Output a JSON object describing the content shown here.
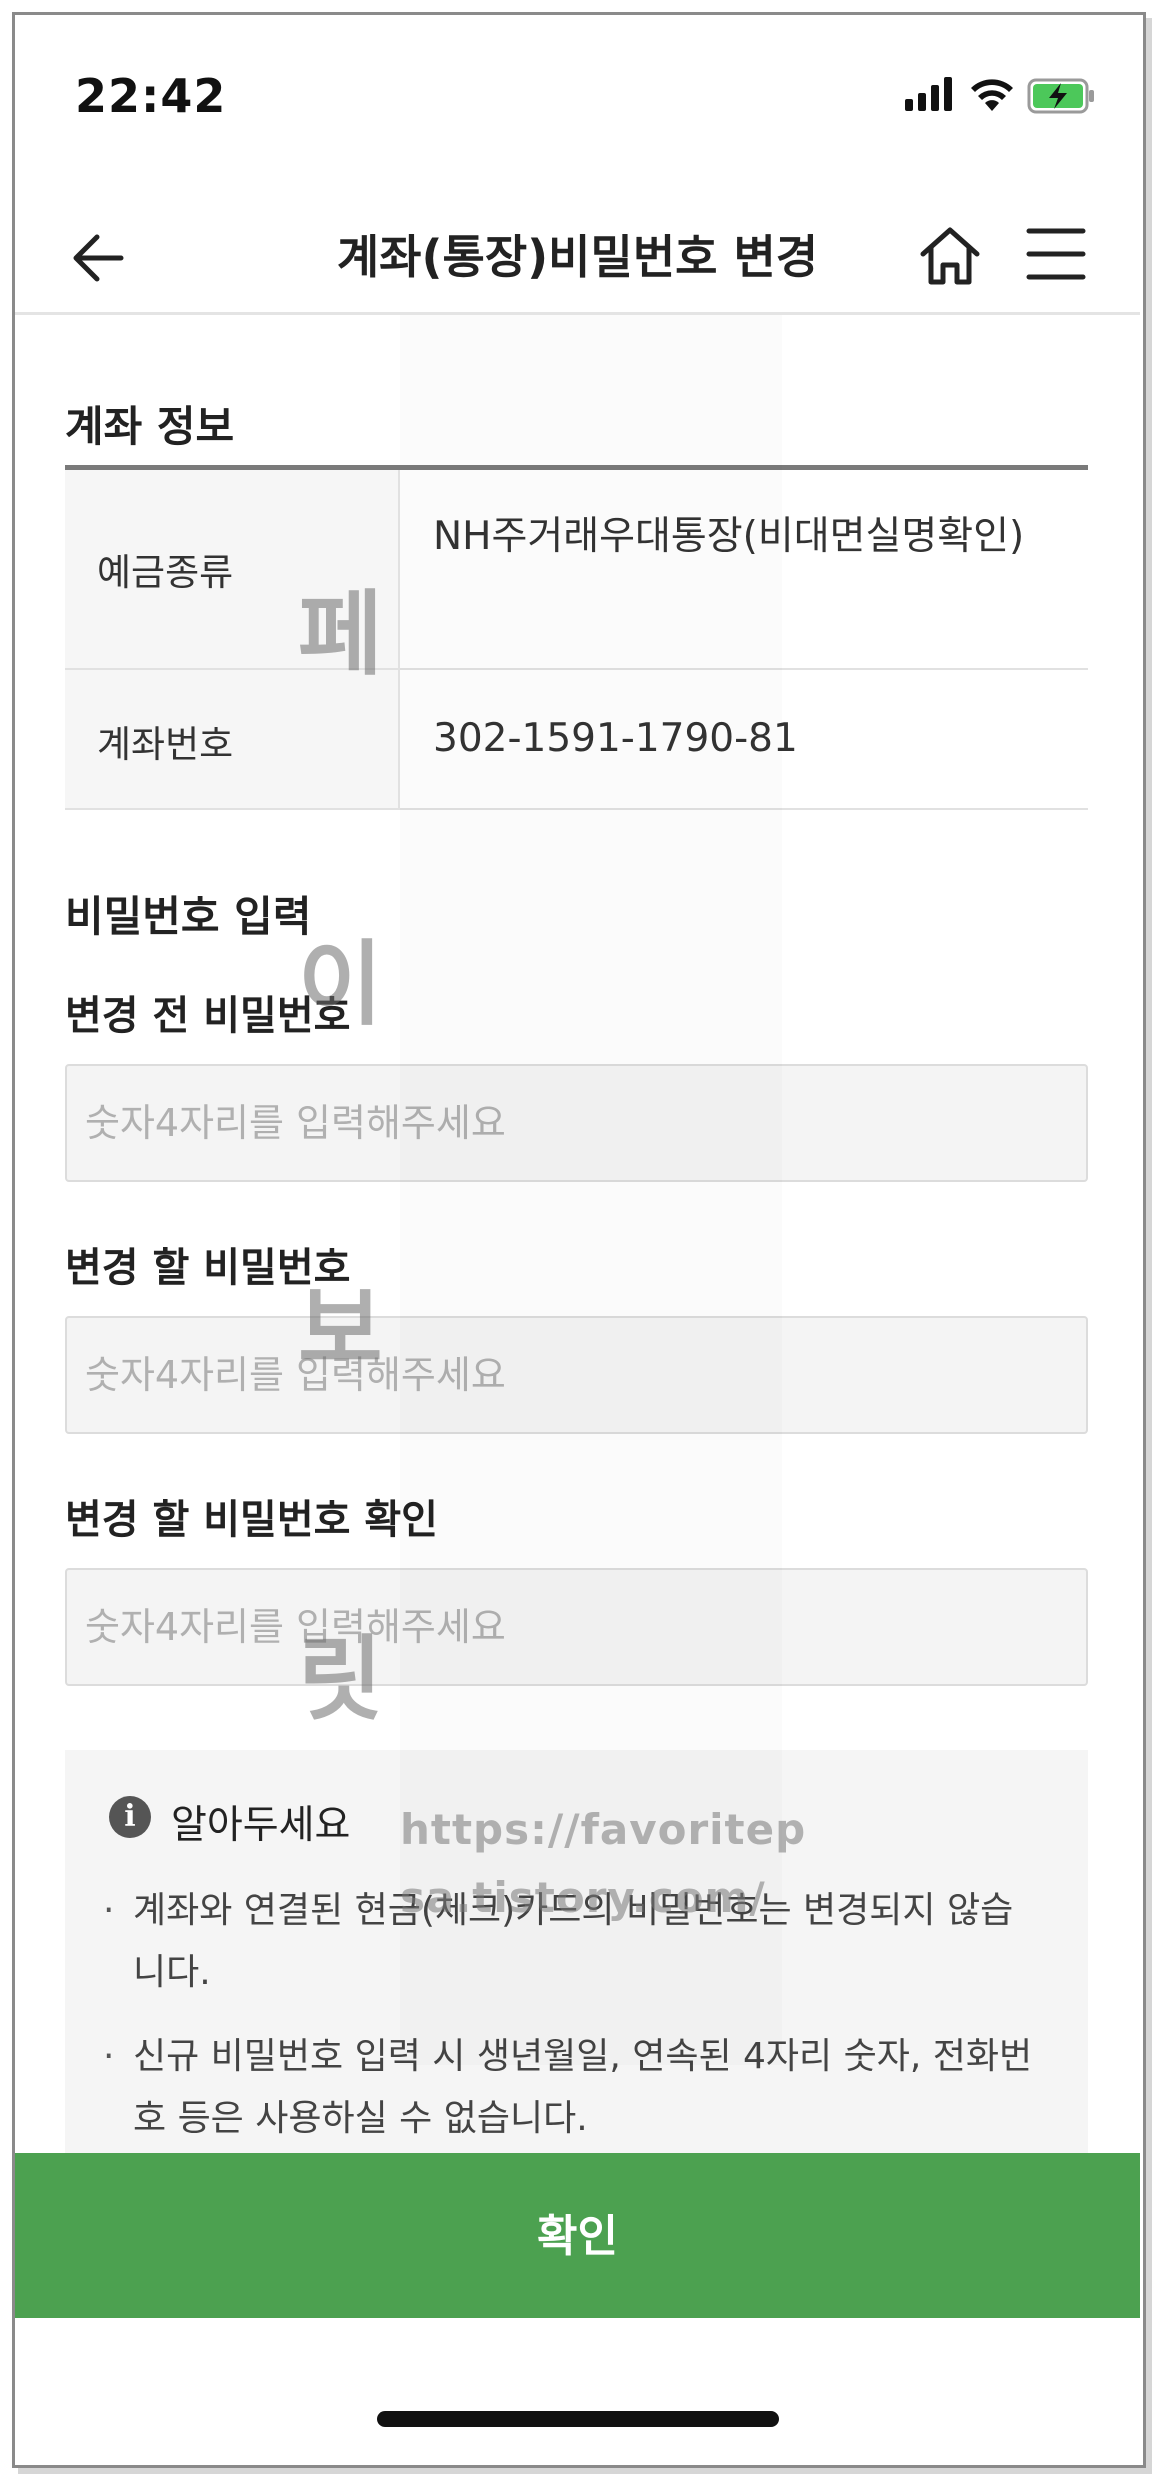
{
  "status_bar": {
    "time": "22:42",
    "icons": [
      "signal-icon",
      "wifi-icon",
      "battery-charging-icon"
    ]
  },
  "header": {
    "title": "계좌(통장)비밀번호 변경",
    "back_icon": "arrow-left-icon",
    "home_icon": "home-icon",
    "menu_icon": "hamburger-menu-icon"
  },
  "account_section": {
    "title": "계좌 정보",
    "rows": [
      {
        "label": "예금종류",
        "value": "NH주거래우대통장(비대면실명확인)"
      },
      {
        "label": "계좌번호",
        "value": "302-1591-1790-81"
      }
    ]
  },
  "password_section": {
    "title": "비밀번호 입력",
    "fields": [
      {
        "label": "변경 전 비밀번호",
        "value": "",
        "placeholder": "숫자4자리를 입력해주세요"
      },
      {
        "label": "변경 할 비밀번호",
        "value": "",
        "placeholder": "숫자4자리를 입력해주세요"
      },
      {
        "label": "변경 할 비밀번호 확인",
        "value": "",
        "placeholder": "숫자4자리를 입력해주세요"
      }
    ]
  },
  "notice": {
    "icon": "info-icon",
    "title": "알아두세요",
    "items": [
      "계좌와 연결된 현금(체크)카드의 비밀번호는 변경되지 않습니다.",
      "신규 비밀번호 입력 시 생년월일, 연속된 4자리 숫자, 전화번호 등은 사용하실 수 없습니다."
    ]
  },
  "confirm_button": "확인",
  "watermark": {
    "chars": [
      "페",
      "이",
      "보",
      "릿"
    ],
    "url_lines": [
      "https://favoritep",
      "sa.tistory.com/"
    ]
  },
  "colors": {
    "accent_green": "#4ca150",
    "account_number_orange": "#e8823d"
  }
}
